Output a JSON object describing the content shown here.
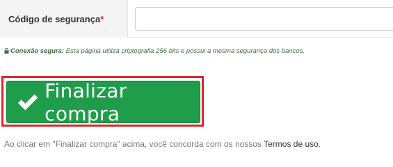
{
  "form": {
    "security_code_label": "Código de segurança",
    "required_mark": "*",
    "security_code_value": ""
  },
  "secure_note": {
    "icon": "lock-icon",
    "title": "Conexão segura:",
    "text": " Esta página utiliza criptografia 256 bits e possui a mesma segurança dos bancos."
  },
  "checkout": {
    "icon": "checkmark-icon",
    "button_label": "Finalizar compra",
    "highlight_color": "#d9272e",
    "button_color": "#1f9d4a"
  },
  "terms": {
    "prefix": "Ao clicar em \"Finalizar compra\" acima, você concorda com os nossos ",
    "link_label": "Termos de uso",
    "suffix": "."
  }
}
